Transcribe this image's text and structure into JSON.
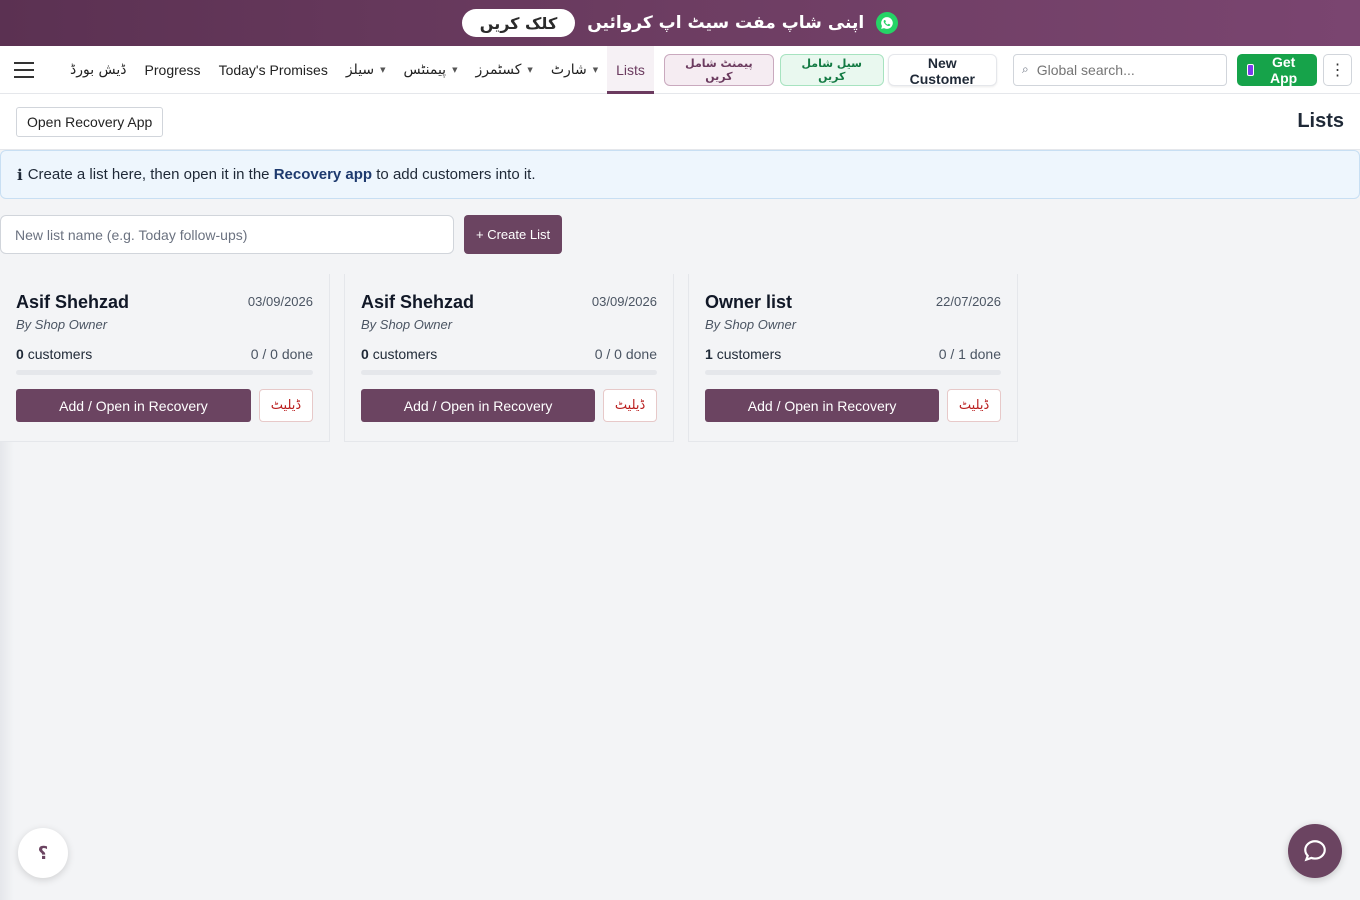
{
  "promo": {
    "button_label": "کلک کریں",
    "text": "اپنی شاپ مفت سیٹ اپ کروائیں",
    "icon": "whatsapp-icon"
  },
  "nav": {
    "items": [
      {
        "label": "ڈیش بورڈ",
        "dropdown": false
      },
      {
        "label": "Progress",
        "dropdown": false
      },
      {
        "label": "Today's Promises",
        "dropdown": false
      },
      {
        "label": "سیلز",
        "dropdown": true
      },
      {
        "label": "پیمنٹس",
        "dropdown": true
      },
      {
        "label": "کسٹمرز",
        "dropdown": true
      },
      {
        "label": "شارٹ",
        "dropdown": true
      },
      {
        "label": "Lists",
        "dropdown": false,
        "active": true
      }
    ],
    "add_payment_label": "پیمنٹ شامل کریں",
    "add_sale_label": "سیل شامل کریں",
    "new_customer_label": "New Customer",
    "search_placeholder": "Global search...",
    "get_app_label": "Get App",
    "accent_color": "#6b4461",
    "green_color": "#16a34a"
  },
  "subheader": {
    "open_recovery_label": "Open Recovery App",
    "title": "Lists"
  },
  "info": {
    "prefix": "Create a list here, then open it in the",
    "link": "Recovery app",
    "suffix": "to add customers into it."
  },
  "create": {
    "placeholder": "New list name (e.g. Today follow-ups)",
    "button_label": "+ Create List"
  },
  "lists": [
    {
      "name": "Asif Shehzad",
      "date": "03/09/2026",
      "by": "By Shop Owner",
      "customers": "0",
      "customers_label": "customers",
      "done": "0 / 0 done",
      "progress": 0,
      "open_label": "Add / Open in Recovery",
      "delete_label": "ڈیلیٹ"
    },
    {
      "name": "Asif Shehzad",
      "date": "03/09/2026",
      "by": "By Shop Owner",
      "customers": "0",
      "customers_label": "customers",
      "done": "0 / 0 done",
      "progress": 0,
      "open_label": "Add / Open in Recovery",
      "delete_label": "ڈیلیٹ"
    },
    {
      "name": "Owner list",
      "date": "22/07/2026",
      "by": "By Shop Owner",
      "customers": "1",
      "customers_label": "customers",
      "done": "0 / 1 done",
      "progress": 0,
      "open_label": "Add / Open in Recovery",
      "delete_label": "ڈیلیٹ"
    }
  ],
  "help_label": "؟"
}
